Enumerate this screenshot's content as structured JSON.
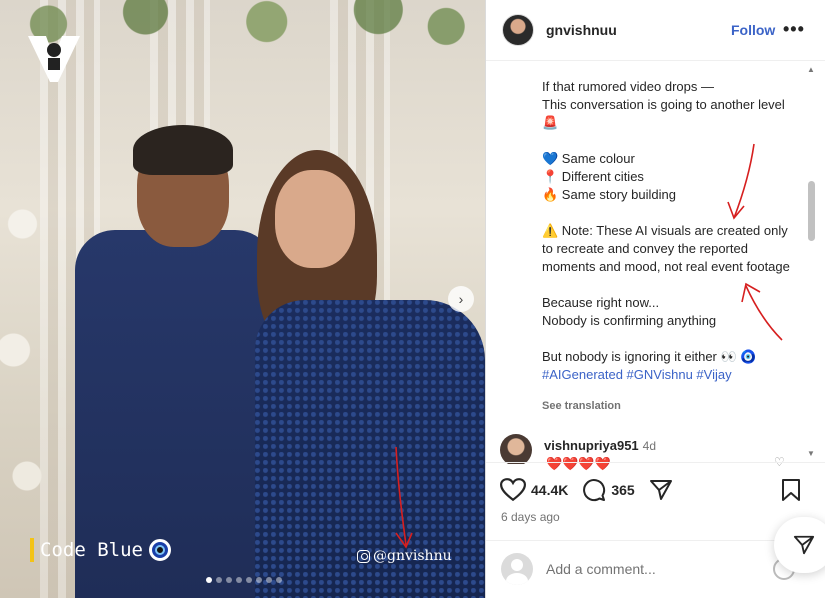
{
  "post": {
    "username": "gnvishnuu",
    "follow_label": "Follow",
    "more_label": "•••"
  },
  "photo": {
    "logo_letter": "V",
    "code_label": "Code Blue",
    "handle": "@gnvishnu",
    "slide_count": 8,
    "active_slide": 0
  },
  "caption": {
    "line1": "If that rumored video drops —",
    "line2": "This conversation is going to another level 🚨",
    "line3": "💙 Same colour",
    "line4": "📍 Different cities",
    "line5": "🔥 Same story building",
    "line6": "⚠️ Note: These AI visuals are created only to recreate and convey the reported moments and mood, not real event footage",
    "line7": "Because right now...",
    "line8": "Nobody is confirming anything",
    "line9": "But nobody is ignoring it either 👀 🧿",
    "hashtags": "#AIGenerated #GNVishnu #Vijay",
    "see_translation": "See translation"
  },
  "comment": {
    "username": "vishnupriya951",
    "time": "4d",
    "hearts": "❤️❤️❤️❤️"
  },
  "actions": {
    "likes": "44.4K",
    "comments": "365",
    "posted": "6 days ago"
  },
  "add_comment": {
    "placeholder": "Add a comment..."
  },
  "colors": {
    "accent": "#3b63c7",
    "annotation": "#d61f1f"
  }
}
